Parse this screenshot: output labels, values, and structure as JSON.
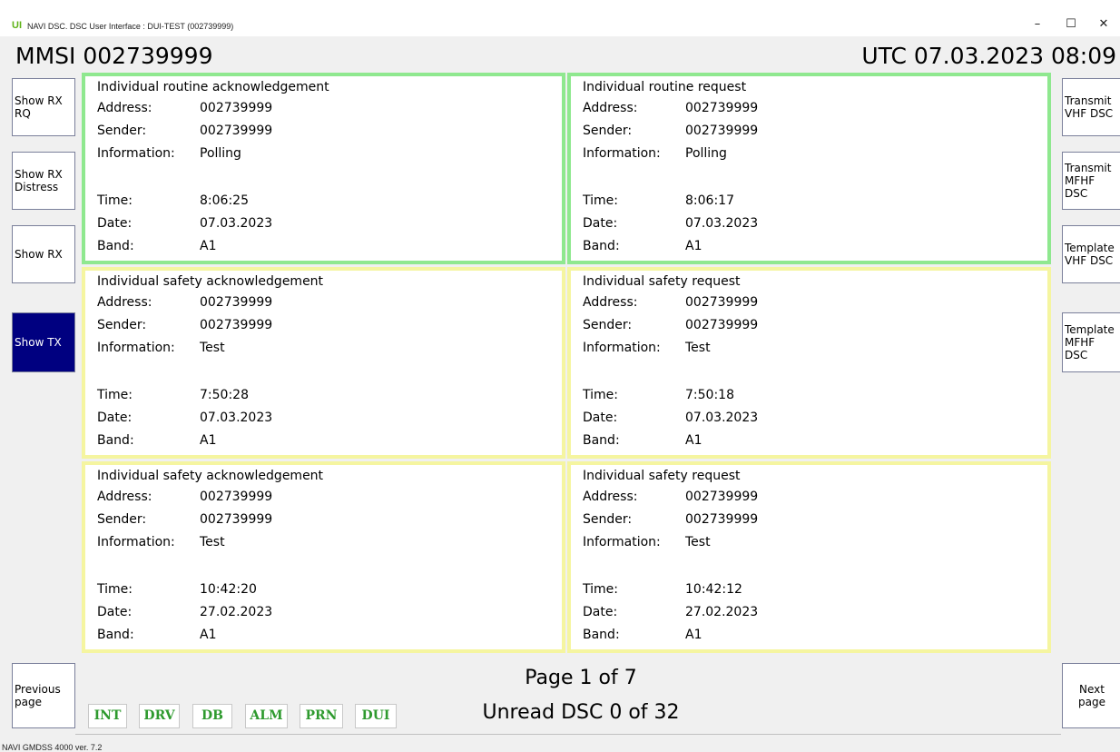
{
  "window": {
    "logo": "UI",
    "title": "NAVI DSC. DSC User Interface : DUI-TEST (002739999)",
    "minimize": "–",
    "maximize": "☐",
    "close": "✕"
  },
  "header": {
    "mmsi": "MMSI 002739999",
    "utc": "UTC 07.03.2023 08:09"
  },
  "left_buttons": [
    {
      "label": "Show RX RQ"
    },
    {
      "label": "Show RX Distress"
    },
    {
      "label": "Show RX"
    },
    {
      "label": "Show TX",
      "active": true
    }
  ],
  "right_buttons": [
    {
      "label": "Transmit VHF DSC"
    },
    {
      "label": "Transmit MFHF DSC"
    },
    {
      "label": "Template VHF DSC"
    },
    {
      "label": "Template MFHF DSC"
    }
  ],
  "field_labels": {
    "address": "Address:",
    "sender": "Sender:",
    "information": "Information:",
    "time": "Time:",
    "date": "Date:",
    "band": "Band:"
  },
  "messages": [
    {
      "title": "Individual routine acknowledgement",
      "address": "002739999",
      "sender": "002739999",
      "information": "Polling",
      "time": "8:06:25",
      "date": "07.03.2023",
      "band": "A1",
      "status_color": "#8fe88f"
    },
    {
      "title": "Individual routine request",
      "address": "002739999",
      "sender": "002739999",
      "information": "Polling",
      "time": "8:06:17",
      "date": "07.03.2023",
      "band": "A1",
      "status_color": "#8fe88f"
    },
    {
      "title": "Individual safety acknowledgement",
      "address": "002739999",
      "sender": "002739999",
      "information": "Test",
      "time": "7:50:28",
      "date": "07.03.2023",
      "band": "A1",
      "status_color": "#f5f5a0"
    },
    {
      "title": "Individual safety request",
      "address": "002739999",
      "sender": "002739999",
      "information": "Test",
      "time": "7:50:18",
      "date": "07.03.2023",
      "band": "A1",
      "status_color": "#f5f5a0"
    },
    {
      "title": "Individual safety acknowledgement",
      "address": "002739999",
      "sender": "002739999",
      "information": "Test",
      "time": "10:42:20",
      "date": "27.02.2023",
      "band": "A1",
      "status_color": "#f5f5a0"
    },
    {
      "title": "Individual safety request",
      "address": "002739999",
      "sender": "002739999",
      "information": "Test",
      "time": "10:42:12",
      "date": "27.02.2023",
      "band": "A1",
      "status_color": "#f5f5a0"
    }
  ],
  "pagination": {
    "previous": "Previous page",
    "next": "Next page",
    "page": "Page 1 of 7",
    "unread": "Unread DSC 0 of 32"
  },
  "function_buttons": [
    "INT",
    "DRV",
    "DB",
    "ALM",
    "PRN",
    "DUI"
  ],
  "status_bar": "NAVI GMDSS 4000 ver. 7.2"
}
